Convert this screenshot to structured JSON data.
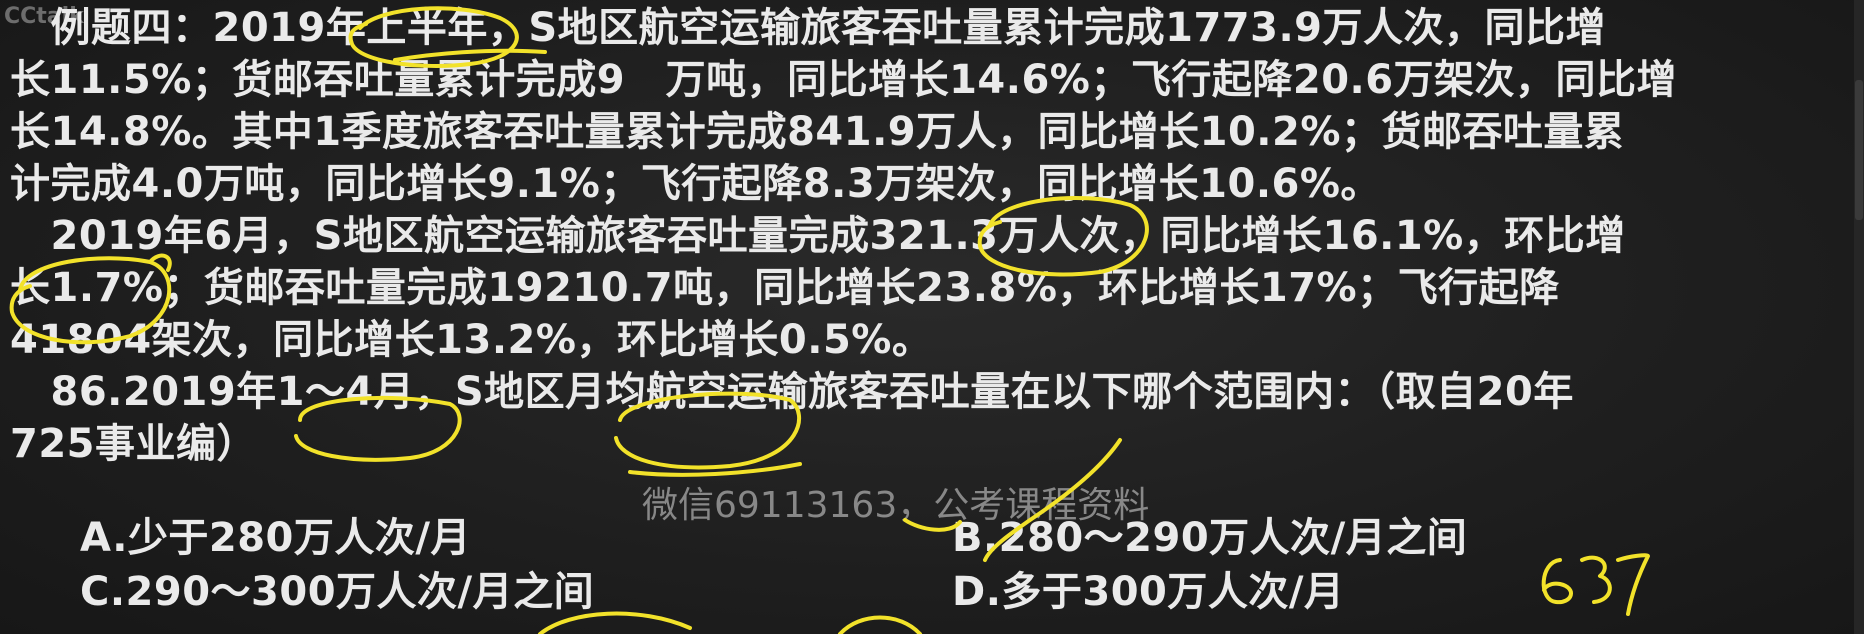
{
  "logo_text": "CCtalk",
  "lines": [
    "　例题四：2019年上半年，S地区航空运输旅客吞吐量累计完成1773.9万人次，同比增",
    "长11.5%；货邮吞吐量累计完成9　万吨，同比增长14.6%；飞行起降20.6万架次，同比增",
    "长14.8%。其中1季度旅客吞吐量累计完成841.9万人，同比增长10.2%；货邮吞吐量累",
    "计完成4.0万吨，同比增长9.1%；飞行起降8.3万架次，同比增长10.6%。",
    "　2019年6月，S地区航空运输旅客吞吐量完成321.3万人次，同比增长16.1%，环比增",
    "长1.7%；货邮吞吐量完成19210.7吨，同比增长23.8%，环比增长17%；飞行起降",
    "41804架次，同比增长13.2%，环比增长0.5%。",
    "　86.2019年1～4月，S地区月均航空运输旅客吞吐量在以下哪个范围内：（取自20年",
    "725事业编）"
  ],
  "options": {
    "a": "A.少于280万人次/月",
    "b": "B.280～290万人次/月之间",
    "c": "C.290～300万人次/月之间",
    "d": "D.多于300万人次/月"
  },
  "watermark": "微信69113163，公考课程资料",
  "handwriting": "637",
  "colors": {
    "background": "#1d1d1d",
    "text": "#eaeaea",
    "ink": "#f2e22a"
  }
}
